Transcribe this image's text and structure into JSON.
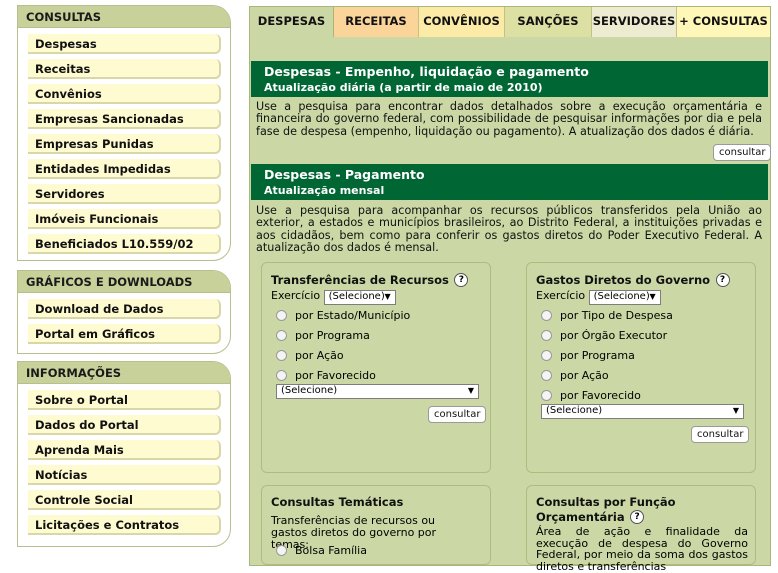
{
  "sidebar": {
    "consultas": {
      "title": "CONSULTAS",
      "items": [
        "Despesas",
        "Receitas",
        "Convênios",
        "Empresas Sancionadas",
        "Empresas Punidas",
        "Entidades Impedidas",
        "Servidores",
        "Imóveis Funcionais",
        "Beneficiados L10.559/02"
      ]
    },
    "graficos": {
      "title": "GRÁFICOS E DOWNLOADS",
      "items": [
        "Download de Dados",
        "Portal em Gráficos"
      ]
    },
    "informacoes": {
      "title": "INFORMAÇÕES",
      "items": [
        "Sobre o Portal",
        "Dados do Portal",
        "Aprenda Mais",
        "Notícias",
        "Controle Social",
        "Licitações e Contratos"
      ]
    }
  },
  "tabs": [
    "DESPESAS",
    "RECEITAS",
    "CONVÊNIOS",
    "SANÇÕES",
    "SERVIDORES",
    "+ CONSULTAS"
  ],
  "tab_colors": [
    "#cbd8a5",
    "#fbd49a",
    "#fbeba7",
    "#dde0a3",
    "#eeecd0",
    "#fff7b8"
  ],
  "empenho": {
    "title": "Despesas - Empenho, liquidação e pagamento",
    "subtitle": "Atualização diária (a partir de maio de 2010)",
    "desc": "Use a pesquisa para encontrar dados detalhados sobre a execução orçamentária e financeira do governo federal, com possibilidade de pesquisar informações por dia e pela fase de despesa (empenho, liquidação ou pagamento). A atualização dos dados é diária.",
    "button": "consultar"
  },
  "pagamento": {
    "title": "Despesas - Pagamento",
    "subtitle": "Atualização mensal",
    "desc": "Use a pesquisa para acompanhar os recursos públicos transferidos pela União ao exterior, a estados e municípios brasileiros, ao Distrito Federal, a instituições privadas e aos cidadãos, bem como para conferir os gastos diretos do Poder Executivo Federal. A atualização dos dados é mensal."
  },
  "transferencias": {
    "title": "Transferências de Recursos",
    "help": "?",
    "exercicio_label": "Exercício",
    "exercicio_value": "(Selecione)",
    "options": [
      "por Estado/Município",
      "por Programa",
      "por Ação",
      "por Favorecido"
    ],
    "select_value": "(Selecione)",
    "button": "consultar"
  },
  "gastos": {
    "title": "Gastos Diretos do Governo",
    "help": "?",
    "exercicio_label": "Exercício",
    "exercicio_value": "(Selecione)",
    "options": [
      "por Tipo de Despesa",
      "por Órgão Executor",
      "por Programa",
      "por Ação",
      "por Favorecido"
    ],
    "select_value": "(Selecione)",
    "button": "consultar"
  },
  "tematicas": {
    "title": "Consultas Temáticas",
    "desc": "Transferências de recursos ou gastos diretos do governo por temas:",
    "options": [
      "Bolsa Família"
    ]
  },
  "funcao": {
    "title": "Consultas por Função Orçamentária",
    "help": "?",
    "desc": "Área de ação e finalidade da execução de despesa do Governo Federal, por meio da soma dos gastos diretos e transferências"
  }
}
